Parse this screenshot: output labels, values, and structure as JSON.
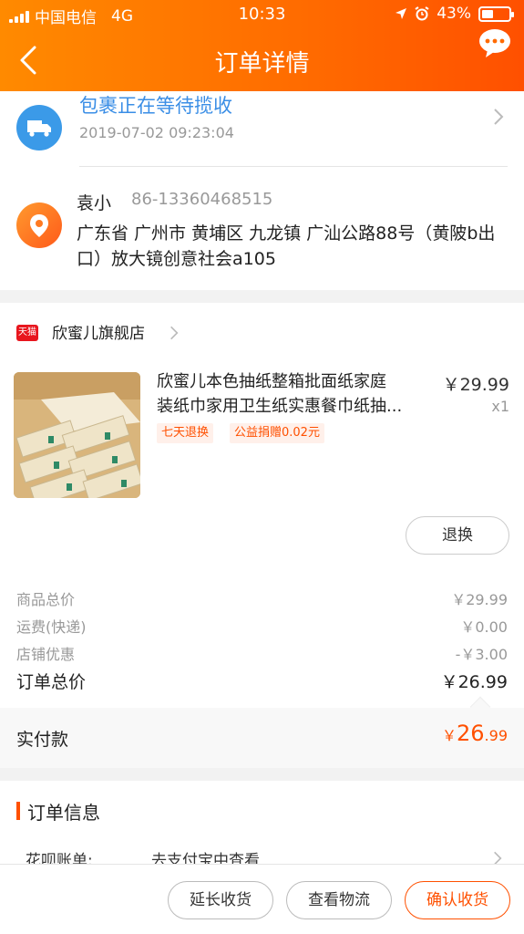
{
  "status_bar": {
    "carrier": "中国电信",
    "network": "4G",
    "time": "10:33",
    "battery": "43%",
    "battery_level": 0.43
  },
  "nav": {
    "title": "订单详情"
  },
  "logistics": {
    "title": "包裹正在等待揽收",
    "time": "2019-07-02 09:23:04"
  },
  "address": {
    "name": "袁小",
    "phone": "86-13360468515",
    "text": "广东省 广州市 黄埔区 九龙镇 广汕公路88号（黄陂b出口）放大镜创意社会a105"
  },
  "shop": {
    "badge": "天猫",
    "name": "欣蜜儿旗舰店"
  },
  "product": {
    "title_line1": "欣蜜儿本色抽纸整箱批面纸家庭",
    "title_line2": "装纸巾家用卫生纸实惠餐巾纸抽...",
    "price": "￥29.99",
    "qty": "x1",
    "tags": [
      "七天退换",
      "公益捐赠0.02元"
    ],
    "refund_button": "退换"
  },
  "fees": [
    {
      "label": "商品总价",
      "value": "￥29.99"
    },
    {
      "label": "运费(快递)",
      "value": "￥0.00"
    },
    {
      "label": "店铺优惠",
      "value": "-￥3.00"
    }
  ],
  "total": {
    "label": "订单总价",
    "value": "￥26.99"
  },
  "paid": {
    "label": "实付款",
    "currency": "￥",
    "integer": "26",
    "decimal": ".99"
  },
  "order_info": {
    "title": "订单信息",
    "row_label": "花呗账单:",
    "row_value": "去支付宝中查看"
  },
  "actions": {
    "extend": "延长收货",
    "logistics": "查看物流",
    "confirm": "确认收货"
  },
  "colors": {
    "accent": "#ff5000",
    "header": "#ff6a00",
    "link": "#3a8ee6"
  }
}
